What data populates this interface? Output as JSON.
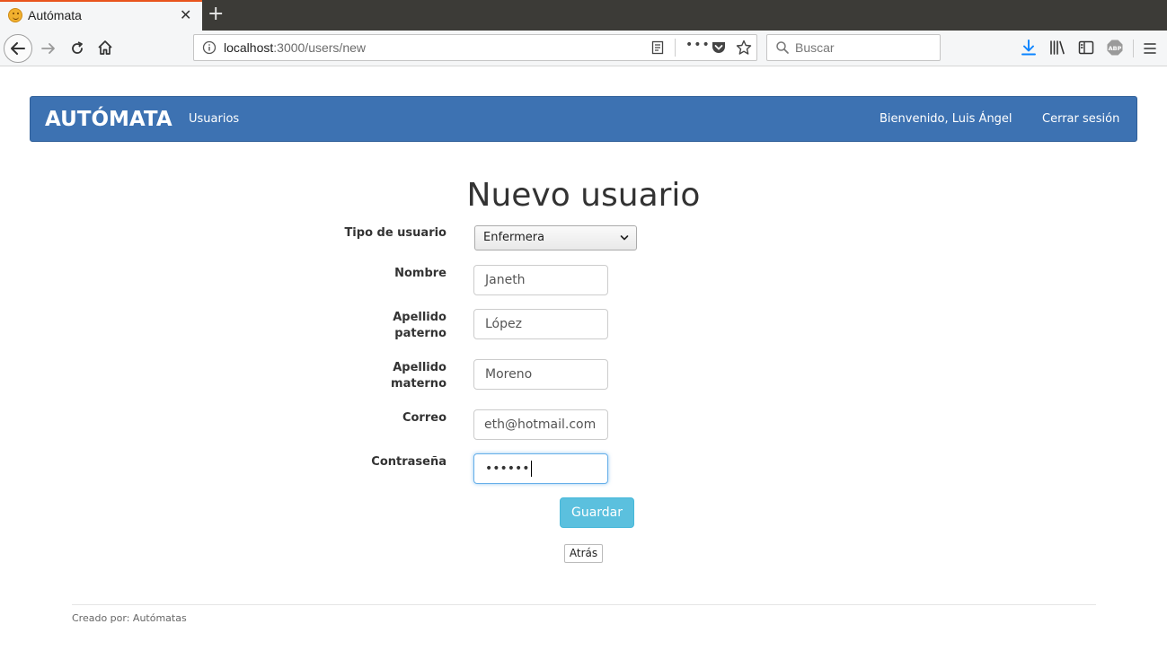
{
  "browser": {
    "tab_title": "Autómata",
    "url_host": "localhost",
    "url_rest": ":3000/users/new",
    "search_placeholder": "Buscar"
  },
  "navbar": {
    "brand": "AUTÓMATA",
    "users_link": "Usuarios",
    "welcome": "Bienvenido, Luis Ángel",
    "logout": "Cerrar sesión",
    "color": "#3d72b2"
  },
  "form": {
    "title": "Nuevo usuario",
    "user_type_label": "Tipo de usuario",
    "user_type_value": "Enfermera",
    "name_label": "Nombre",
    "name_value": "Janeth",
    "paternal_label_1": "Apellido",
    "paternal_label_2": "paterno",
    "paternal_value": "López",
    "maternal_label_1": "Apellido",
    "maternal_label_2": "materno",
    "maternal_value": "Moreno",
    "email_label": "Correo",
    "email_value": "eth@hotmail.com",
    "password_label": "Contraseña",
    "password_value": "••••••",
    "save_button": "Guardar",
    "back_button": "Atrás"
  },
  "footer": {
    "text": "Creado por: Autómatas"
  }
}
